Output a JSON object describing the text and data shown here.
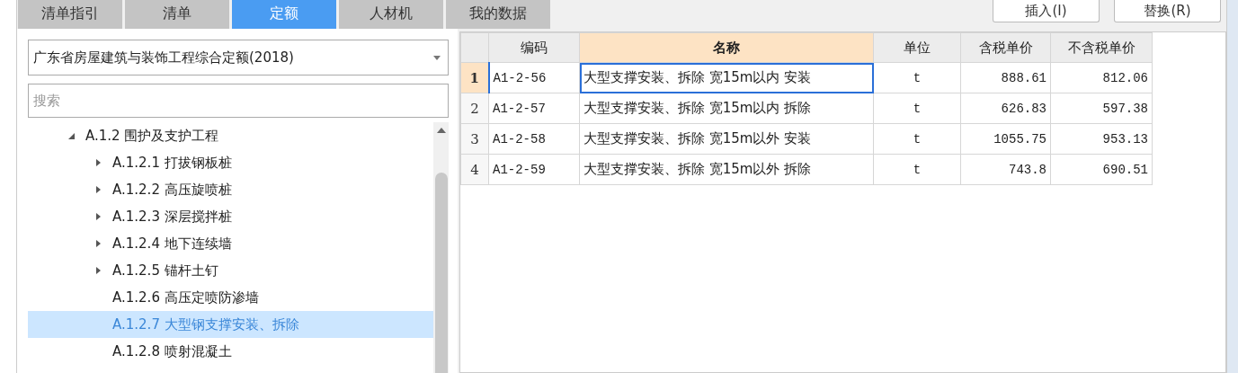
{
  "tabs": [
    {
      "label": "清单指引",
      "selected": false
    },
    {
      "label": "清单",
      "selected": false
    },
    {
      "label": "定额",
      "selected": true
    },
    {
      "label": "人材机",
      "selected": false
    },
    {
      "label": "我的数据",
      "selected": false
    }
  ],
  "buttons": [
    {
      "label": "插入(I)"
    },
    {
      "label": "替换(R)"
    }
  ],
  "library_dropdown": {
    "value": "广东省房屋建筑与装饰工程综合定额(2018)"
  },
  "search": {
    "placeholder": "搜索"
  },
  "tree": [
    {
      "label": "A.1.2 围护及支护工程",
      "expanded": true,
      "selected": false,
      "children": [
        {
          "label": "A.1.2.1 打拔钢板桩",
          "expanded": false,
          "selected": false
        },
        {
          "label": "A.1.2.2 高压旋喷桩",
          "expanded": false,
          "selected": false
        },
        {
          "label": "A.1.2.3 深层搅拌桩",
          "expanded": false,
          "selected": false
        },
        {
          "label": "A.1.2.4 地下连续墙",
          "expanded": false,
          "selected": false
        },
        {
          "label": "A.1.2.5 锚杆土钉",
          "expanded": false,
          "selected": false
        },
        {
          "label": "A.1.2.6 高压定喷防渗墙",
          "selected": false
        },
        {
          "label": "A.1.2.7 大型钢支撑安装、拆除",
          "selected": true
        },
        {
          "label": "A.1.2.8 喷射混凝土",
          "selected": false
        }
      ]
    }
  ],
  "table": {
    "columns": [
      {
        "label": "编码",
        "selected": false
      },
      {
        "label": "名称",
        "selected": true
      },
      {
        "label": "单位",
        "selected": false
      },
      {
        "label": "含税单价",
        "selected": false
      },
      {
        "label": "不含税单价",
        "selected": false
      }
    ],
    "rows": [
      {
        "index": "1",
        "selected": true,
        "cells": [
          "A1-2-56",
          "大型支撑安装、拆除 宽15m以内 安装",
          "t",
          "888.61",
          "812.06"
        ]
      },
      {
        "index": "2",
        "selected": false,
        "cells": [
          "A1-2-57",
          "大型支撑安装、拆除 宽15m以内 拆除",
          "t",
          "626.83",
          "597.38"
        ]
      },
      {
        "index": "3",
        "selected": false,
        "cells": [
          "A1-2-58",
          "大型支撑安装、拆除 宽15m以外 安装",
          "t",
          "1055.75",
          "953.13"
        ]
      },
      {
        "index": "4",
        "selected": false,
        "cells": [
          "A1-2-59",
          "大型支撑安装、拆除 宽15m以外 拆除",
          "t",
          "743.8",
          "690.51"
        ]
      }
    ]
  }
}
